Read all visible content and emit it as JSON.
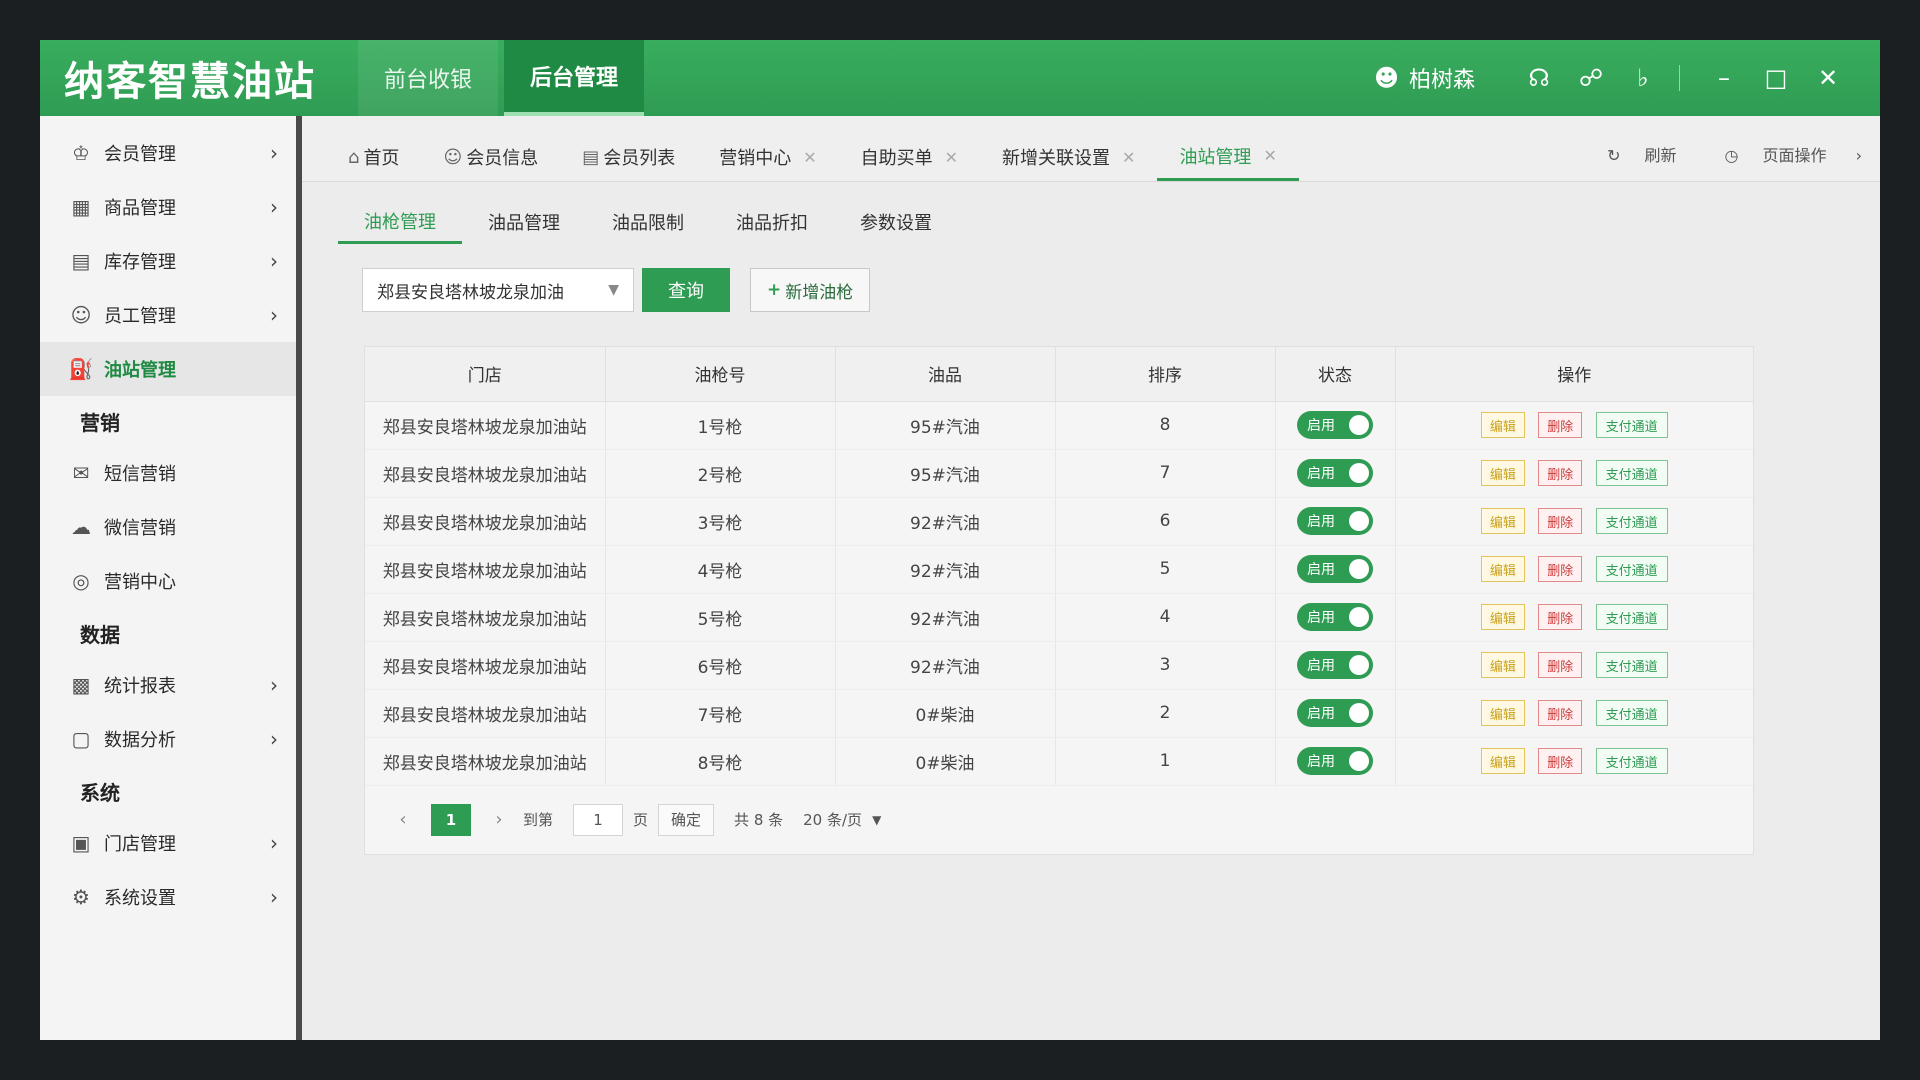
{
  "app": {
    "logo": "纳客智慧油站",
    "top_tabs": [
      "前台收银",
      "后台管理"
    ],
    "user_name": "柏树森"
  },
  "sidebar": {
    "items": [
      {
        "label": "会员管理",
        "icon": "member-icon"
      },
      {
        "label": "商品管理",
        "icon": "goods-icon"
      },
      {
        "label": "库存管理",
        "icon": "inventory-icon"
      },
      {
        "label": "员工管理",
        "icon": "staff-icon"
      },
      {
        "label": "油站管理",
        "icon": "station-icon"
      }
    ],
    "section_marketing": "营销",
    "marketing_items": [
      {
        "label": "短信营销",
        "icon": "sms-icon"
      },
      {
        "label": "微信营销",
        "icon": "wechat-icon"
      },
      {
        "label": "营销中心",
        "icon": "target-icon"
      }
    ],
    "section_data": "数据",
    "data_items": [
      {
        "label": "统计报表",
        "icon": "chart-icon"
      },
      {
        "label": "数据分析",
        "icon": "analysis-icon"
      }
    ],
    "section_system": "系统",
    "system_items": [
      {
        "label": "门店管理",
        "icon": "store-icon"
      },
      {
        "label": "系统设置",
        "icon": "settings-icon"
      }
    ]
  },
  "page_tabs": [
    {
      "label": "首页"
    },
    {
      "label": "会员信息"
    },
    {
      "label": "会员列表"
    },
    {
      "label": "营销中心"
    },
    {
      "label": "自助买单"
    },
    {
      "label": "新增关联设置"
    },
    {
      "label": "油站管理"
    }
  ],
  "page_actions": {
    "refresh": "刷新",
    "page_ops": "页面操作"
  },
  "sub_tabs": [
    "油枪管理",
    "油品管理",
    "油品限制",
    "油品折扣",
    "参数设置"
  ],
  "toolbar": {
    "store_select": "郑县安良塔林坡龙泉加油",
    "query_label": "查询",
    "add_label": "新增油枪"
  },
  "table": {
    "headers": [
      "门店",
      "油枪号",
      "油品",
      "排序",
      "状态",
      "操作"
    ],
    "status_label": "启用",
    "op_labels": {
      "edit": "编辑",
      "delete": "删除",
      "pay": "支付通道"
    },
    "rows": [
      {
        "store": "郑县安良塔林坡龙泉加油站",
        "gun": "1号枪",
        "oil": "95#汽油",
        "order": "8"
      },
      {
        "store": "郑县安良塔林坡龙泉加油站",
        "gun": "2号枪",
        "oil": "95#汽油",
        "order": "7"
      },
      {
        "store": "郑县安良塔林坡龙泉加油站",
        "gun": "3号枪",
        "oil": "92#汽油",
        "order": "6"
      },
      {
        "store": "郑县安良塔林坡龙泉加油站",
        "gun": "4号枪",
        "oil": "92#汽油",
        "order": "5"
      },
      {
        "store": "郑县安良塔林坡龙泉加油站",
        "gun": "5号枪",
        "oil": "92#汽油",
        "order": "4"
      },
      {
        "store": "郑县安良塔林坡龙泉加油站",
        "gun": "6号枪",
        "oil": "92#汽油",
        "order": "3"
      },
      {
        "store": "郑县安良塔林坡龙泉加油站",
        "gun": "7号枪",
        "oil": "0#柴油",
        "order": "2"
      },
      {
        "store": "郑县安良塔林坡龙泉加油站",
        "gun": "8号枪",
        "oil": "0#柴油",
        "order": "1"
      }
    ]
  },
  "pager": {
    "current": "1",
    "goto_label": "到第",
    "goto_value": "1",
    "page_unit": "页",
    "confirm": "确定",
    "total": "共 8 条",
    "page_size": "20 条/页"
  },
  "colors": {
    "brand": "#2f9c53",
    "edit": "#c9a21a",
    "delete": "#cc3b3b"
  }
}
